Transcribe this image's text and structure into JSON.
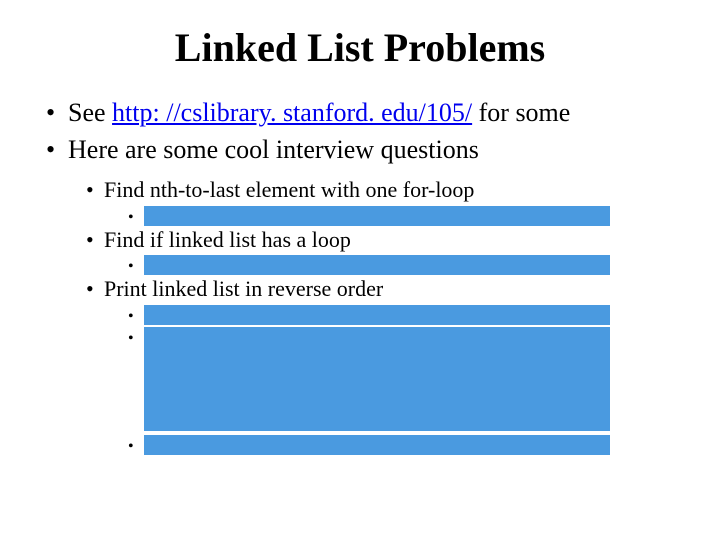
{
  "title": "Linked List Problems",
  "bullets": {
    "see_prefix": "See ",
    "see_link": "http: //cslibrary. stanford. edu/105/",
    "see_suffix": " for some",
    "line2": "Here are some cool interview questions",
    "sub": {
      "a": "Find nth-to-last element with one for-loop",
      "b": "Find if linked list has a loop",
      "c": "Print linked list in reverse order"
    }
  }
}
